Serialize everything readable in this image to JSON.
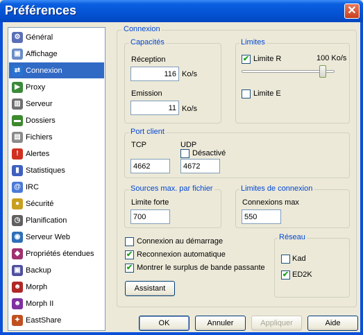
{
  "window": {
    "title": "Préférences",
    "close_glyph": "✕"
  },
  "sidebar": {
    "items": [
      {
        "label": "Général",
        "icon": "gear-icon",
        "color": "#5a6fb8",
        "glyph": "⚙"
      },
      {
        "label": "Affichage",
        "icon": "display-icon",
        "color": "#6a8cc8",
        "glyph": "▣"
      },
      {
        "label": "Connexion",
        "icon": "connection-icon",
        "color": "#2a73d0",
        "glyph": "⇄",
        "active": true
      },
      {
        "label": "Proxy",
        "icon": "proxy-icon",
        "color": "#3a8a3a",
        "glyph": "▶"
      },
      {
        "label": "Serveur",
        "icon": "server-icon",
        "color": "#707070",
        "glyph": "▥"
      },
      {
        "label": "Dossiers",
        "icon": "folder-icon",
        "color": "#3d8a2e",
        "glyph": "▬"
      },
      {
        "label": "Fichiers",
        "icon": "files-icon",
        "color": "#8a8a8a",
        "glyph": "▤"
      },
      {
        "label": "Alertes",
        "icon": "alerts-icon",
        "color": "#d03020",
        "glyph": "!"
      },
      {
        "label": "Statistiques",
        "icon": "statistics-icon",
        "color": "#4060c0",
        "glyph": "▮"
      },
      {
        "label": "IRC",
        "icon": "irc-icon",
        "color": "#4a7ad8",
        "glyph": "@"
      },
      {
        "label": "Sécurité",
        "icon": "lock-icon",
        "color": "#c8a020",
        "glyph": "●"
      },
      {
        "label": "Planification",
        "icon": "clock-icon",
        "color": "#606060",
        "glyph": "◷"
      },
      {
        "label": "Serveur Web",
        "icon": "web-server-icon",
        "color": "#2d6fb8",
        "glyph": "◉"
      },
      {
        "label": "Propriétés étendues",
        "icon": "extended-properties-icon",
        "color": "#a03070",
        "glyph": "◆"
      },
      {
        "label": "Backup",
        "icon": "backup-icon",
        "color": "#5050a0",
        "glyph": "▣"
      },
      {
        "label": "Morph",
        "icon": "morph-icon",
        "color": "#b02828",
        "glyph": "☻"
      },
      {
        "label": "Morph II",
        "icon": "morph-ii-icon",
        "color": "#8030a0",
        "glyph": "☻"
      },
      {
        "label": "EastShare",
        "icon": "eastshare-icon",
        "color": "#c05020",
        "glyph": "✦"
      }
    ]
  },
  "connexion": {
    "title": "Connexion",
    "capacites": {
      "title": "Capacités",
      "reception_label": "Réception",
      "reception_value": "116",
      "reception_unit": "Ko/s",
      "emission_label": "Emission",
      "emission_value": "11",
      "emission_unit": "Ko/s"
    },
    "limites": {
      "title": "Limites",
      "limite_r_label": "Limite R",
      "limite_r_checked": true,
      "limite_r_value": "100 Ko/s",
      "slider_fraction": 0.9,
      "limite_e_label": "Limite E",
      "limite_e_checked": false
    },
    "port_client": {
      "title": "Port client",
      "tcp_label": "TCP",
      "tcp_value": "4662",
      "udp_label": "UDP",
      "desactive_label": "Désactivé",
      "desactive_checked": false,
      "udp_value": "4672"
    },
    "sources_max": {
      "title": "Sources max. par fichier",
      "limite_forte_label": "Limite forte",
      "limite_forte_value": "700"
    },
    "limites_connexion": {
      "title": "Limites de connexion",
      "connexions_max_label": "Connexions max",
      "connexions_max_value": "550"
    },
    "options": [
      {
        "label": "Connexion au démarrage",
        "checked": false
      },
      {
        "label": "Reconnexion automatique",
        "checked": true
      },
      {
        "label": "Montrer le surplus de bande passante",
        "checked": true
      }
    ],
    "reseau": {
      "title": "Réseau",
      "kad_label": "Kad",
      "kad_checked": false,
      "ed2k_label": "ED2K",
      "ed2k_checked": true
    },
    "assistant_label": "Assistant"
  },
  "footer": {
    "ok_label": "OK",
    "annuler_label": "Annuler",
    "appliquer_label": "Appliquer",
    "aide_label": "Aide"
  },
  "colors": {
    "titlebar": "#0453d4",
    "selection": "#316ac5",
    "group_title": "#0046d5",
    "check": "#21a121"
  }
}
